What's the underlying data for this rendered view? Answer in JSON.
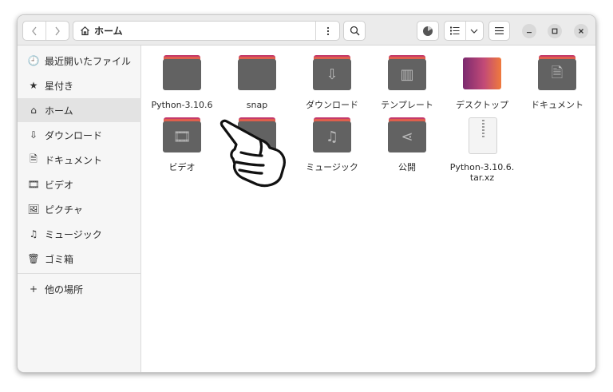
{
  "pathbar": {
    "icon": "home-icon",
    "label": "ホーム"
  },
  "sidebar": {
    "items": [
      {
        "label": "最近開いたファイル",
        "icon": "recent-icon",
        "glyph": "🕘"
      },
      {
        "label": "星付き",
        "icon": "star-icon",
        "glyph": "★"
      },
      {
        "label": "ホーム",
        "icon": "home-icon",
        "glyph": "⌂",
        "active": true
      },
      {
        "label": "ダウンロード",
        "icon": "download-icon",
        "glyph": "⇩"
      },
      {
        "label": "ドキュメント",
        "icon": "document-icon",
        "glyph": "🗎"
      },
      {
        "label": "ビデオ",
        "icon": "video-icon",
        "glyph": "🎞"
      },
      {
        "label": "ピクチャ",
        "icon": "picture-icon",
        "glyph": "🖼"
      },
      {
        "label": "ミュージック",
        "icon": "music-icon",
        "glyph": "♫"
      },
      {
        "label": "ゴミ箱",
        "icon": "trash-icon",
        "glyph": "🗑"
      }
    ],
    "other_locations": {
      "label": "他の場所",
      "glyph": "+"
    }
  },
  "files": [
    {
      "label": "Python-3.10.6",
      "type": "folder",
      "icon": "folder-icon",
      "glyph": ""
    },
    {
      "label": "snap",
      "type": "folder",
      "icon": "folder-icon",
      "glyph": ""
    },
    {
      "label": "ダウンロード",
      "type": "folder",
      "icon": "download-folder-icon",
      "glyph": "⇩"
    },
    {
      "label": "テンプレート",
      "type": "folder",
      "icon": "templates-folder-icon",
      "glyph": "▥"
    },
    {
      "label": "デスクトップ",
      "type": "desktop",
      "icon": "desktop-folder-icon",
      "glyph": ""
    },
    {
      "label": "ドキュメント",
      "type": "folder",
      "icon": "documents-folder-icon",
      "glyph": "🗎"
    },
    {
      "label": "ビデオ",
      "type": "folder",
      "icon": "videos-folder-icon",
      "glyph": "🎞"
    },
    {
      "label": "ャ",
      "type": "folder",
      "icon": "pictures-folder-icon",
      "glyph": ""
    },
    {
      "label": "ミュージック",
      "type": "folder",
      "icon": "music-folder-icon",
      "glyph": "♫"
    },
    {
      "label": "公開",
      "type": "folder",
      "icon": "public-folder-icon",
      "glyph": "⋖"
    },
    {
      "label": "Python-3.10.6.\ntar.xz",
      "type": "archive",
      "icon": "archive-file-icon",
      "glyph": ""
    }
  ],
  "colors": {
    "accent_folder_tab": "#c5396a",
    "folder_body": "#626262",
    "sidebar_bg": "#f6f6f6"
  }
}
